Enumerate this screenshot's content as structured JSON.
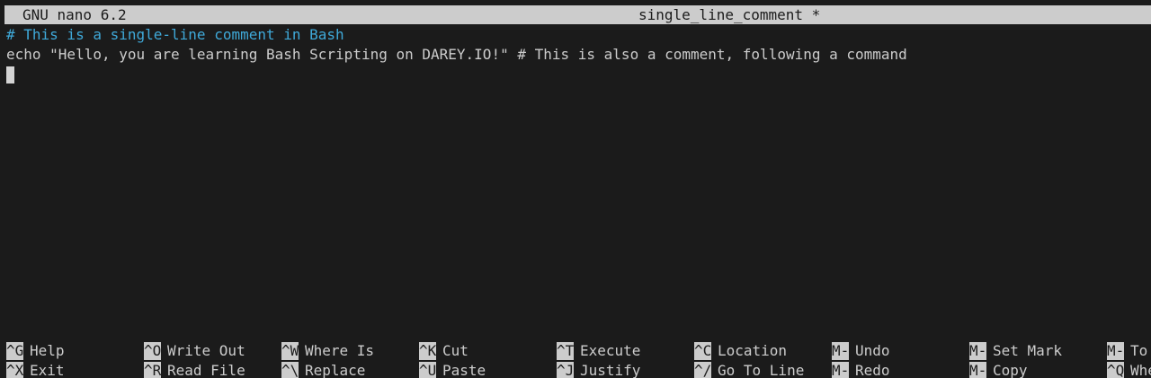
{
  "titlebar": {
    "app": "GNU nano 6.2",
    "filename": "single_line_comment *"
  },
  "editor": {
    "lines": [
      "# This is a single-line comment in Bash",
      "echo \"Hello, you are learning Bash Scripting on DAREY.IO!\" # This is also a comment, following a command"
    ]
  },
  "shortcuts": {
    "row1": [
      {
        "key": "^G",
        "label": "Help"
      },
      {
        "key": "^O",
        "label": "Write Out"
      },
      {
        "key": "^W",
        "label": "Where Is"
      },
      {
        "key": "^K",
        "label": "Cut"
      },
      {
        "key": "^T",
        "label": "Execute"
      },
      {
        "key": "^C",
        "label": "Location"
      },
      {
        "key": "M-U",
        "label": "Undo"
      },
      {
        "key": "M-A",
        "label": "Set Mark"
      },
      {
        "key": "M-]",
        "label": "To Bracket"
      }
    ],
    "row2": [
      {
        "key": "^X",
        "label": "Exit"
      },
      {
        "key": "^R",
        "label": "Read File"
      },
      {
        "key": "^\\",
        "label": "Replace"
      },
      {
        "key": "^U",
        "label": "Paste"
      },
      {
        "key": "^J",
        "label": "Justify"
      },
      {
        "key": "^/",
        "label": "Go To Line"
      },
      {
        "key": "M-E",
        "label": "Redo"
      },
      {
        "key": "M-6",
        "label": "Copy"
      },
      {
        "key": "^Q",
        "label": "Where Was"
      }
    ]
  }
}
